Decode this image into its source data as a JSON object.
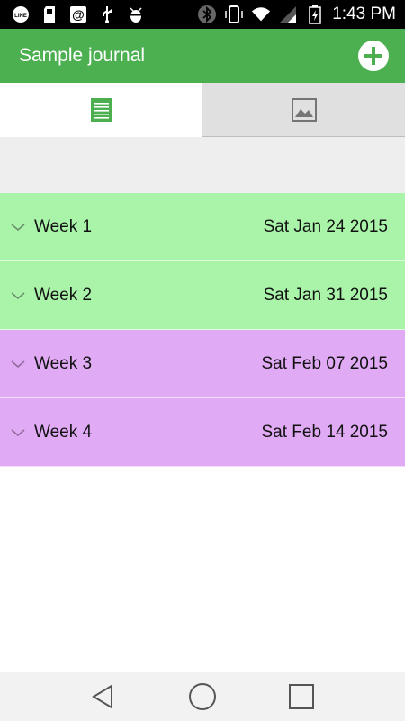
{
  "status_bar": {
    "time": "1:43 PM",
    "left_icons": [
      "line-app-icon",
      "sd-card-icon",
      "at-sign-icon",
      "usb-icon",
      "android-debug-icon"
    ],
    "right_icons": [
      "bluetooth-icon",
      "vibrate-icon",
      "wifi-icon",
      "signal-icon",
      "battery-icon"
    ]
  },
  "app_bar": {
    "title": "Sample journal",
    "color": "#4caf50"
  },
  "tabs": [
    {
      "icon": "document-icon",
      "active": true
    },
    {
      "icon": "image-icon",
      "active": false
    }
  ],
  "weeks": [
    {
      "label": "Week 1",
      "date": "Sat Jan 24 2015",
      "color": "#aaf4aa"
    },
    {
      "label": "Week 2",
      "date": "Sat Jan 31 2015",
      "color": "#aaf4aa"
    },
    {
      "label": "Week 3",
      "date": "Sat Feb 07 2015",
      "color": "#e0aaf4"
    },
    {
      "label": "Week 4",
      "date": "Sat Feb 14 2015",
      "color": "#e0aaf4"
    }
  ],
  "nav_bar": {
    "buttons": [
      "back-icon",
      "home-icon",
      "recents-icon"
    ]
  }
}
